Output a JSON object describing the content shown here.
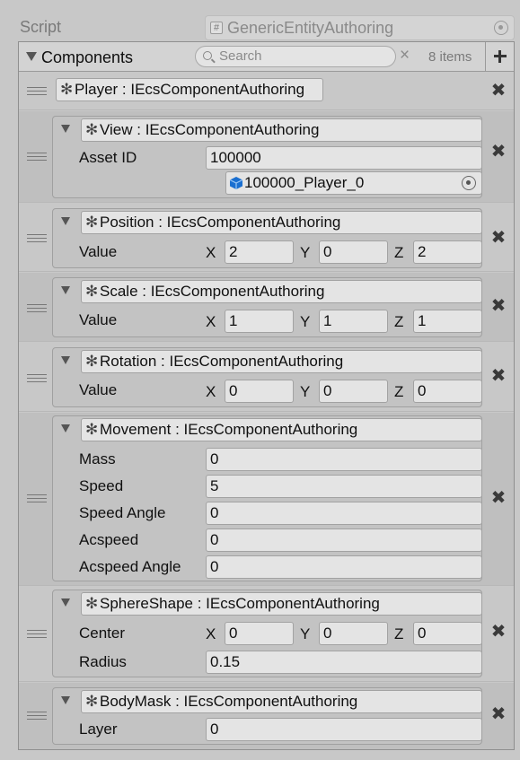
{
  "script": {
    "label": "Script",
    "value": "GenericEntityAuthoring",
    "hash_glyph": "#"
  },
  "list": {
    "title": "Components",
    "search_placeholder": "Search",
    "clear_glyph": "×",
    "count": "8 items"
  },
  "glyphs": {
    "remove": "✖",
    "asterisk": "✻"
  },
  "components": {
    "player": {
      "type": "Player : IEcsComponentAuthoring"
    },
    "view": {
      "type": "View : IEcsComponentAuthoring",
      "asset_id_label": "Asset ID",
      "asset_id": "100000",
      "asset_ref": "100000_Player_0"
    },
    "position": {
      "type": "Position : IEcsComponentAuthoring",
      "label": "Value",
      "x": "2",
      "y": "0",
      "z": "2"
    },
    "scale": {
      "type": "Scale : IEcsComponentAuthoring",
      "label": "Value",
      "x": "1",
      "y": "1",
      "z": "1"
    },
    "rotation": {
      "type": "Rotation : IEcsComponentAuthoring",
      "label": "Value",
      "x": "0",
      "y": "0",
      "z": "0"
    },
    "movement": {
      "type": "Movement : IEcsComponentAuthoring",
      "mass_label": "Mass",
      "mass": "0",
      "speed_label": "Speed",
      "speed": "5",
      "speed_angle_label": "Speed Angle",
      "speed_angle": "0",
      "acspeed_label": "Acspeed",
      "acspeed": "0",
      "acspeed_angle_label": "Acspeed Angle",
      "acspeed_angle": "0"
    },
    "sphere": {
      "type": "SphereShape : IEcsComponentAuthoring",
      "center_label": "Center",
      "x": "0",
      "y": "0",
      "z": "0",
      "radius_label": "Radius",
      "radius": "0.15"
    },
    "bodymask": {
      "type": "BodyMask : IEcsComponentAuthoring",
      "layer_label": "Layer",
      "layer": "0"
    }
  },
  "axes": {
    "x": "X",
    "y": "Y",
    "z": "Z"
  },
  "colors": {
    "asset_icon": "#1a6fd0",
    "panel": "#c8c8c8",
    "field": "#e4e4e4"
  }
}
